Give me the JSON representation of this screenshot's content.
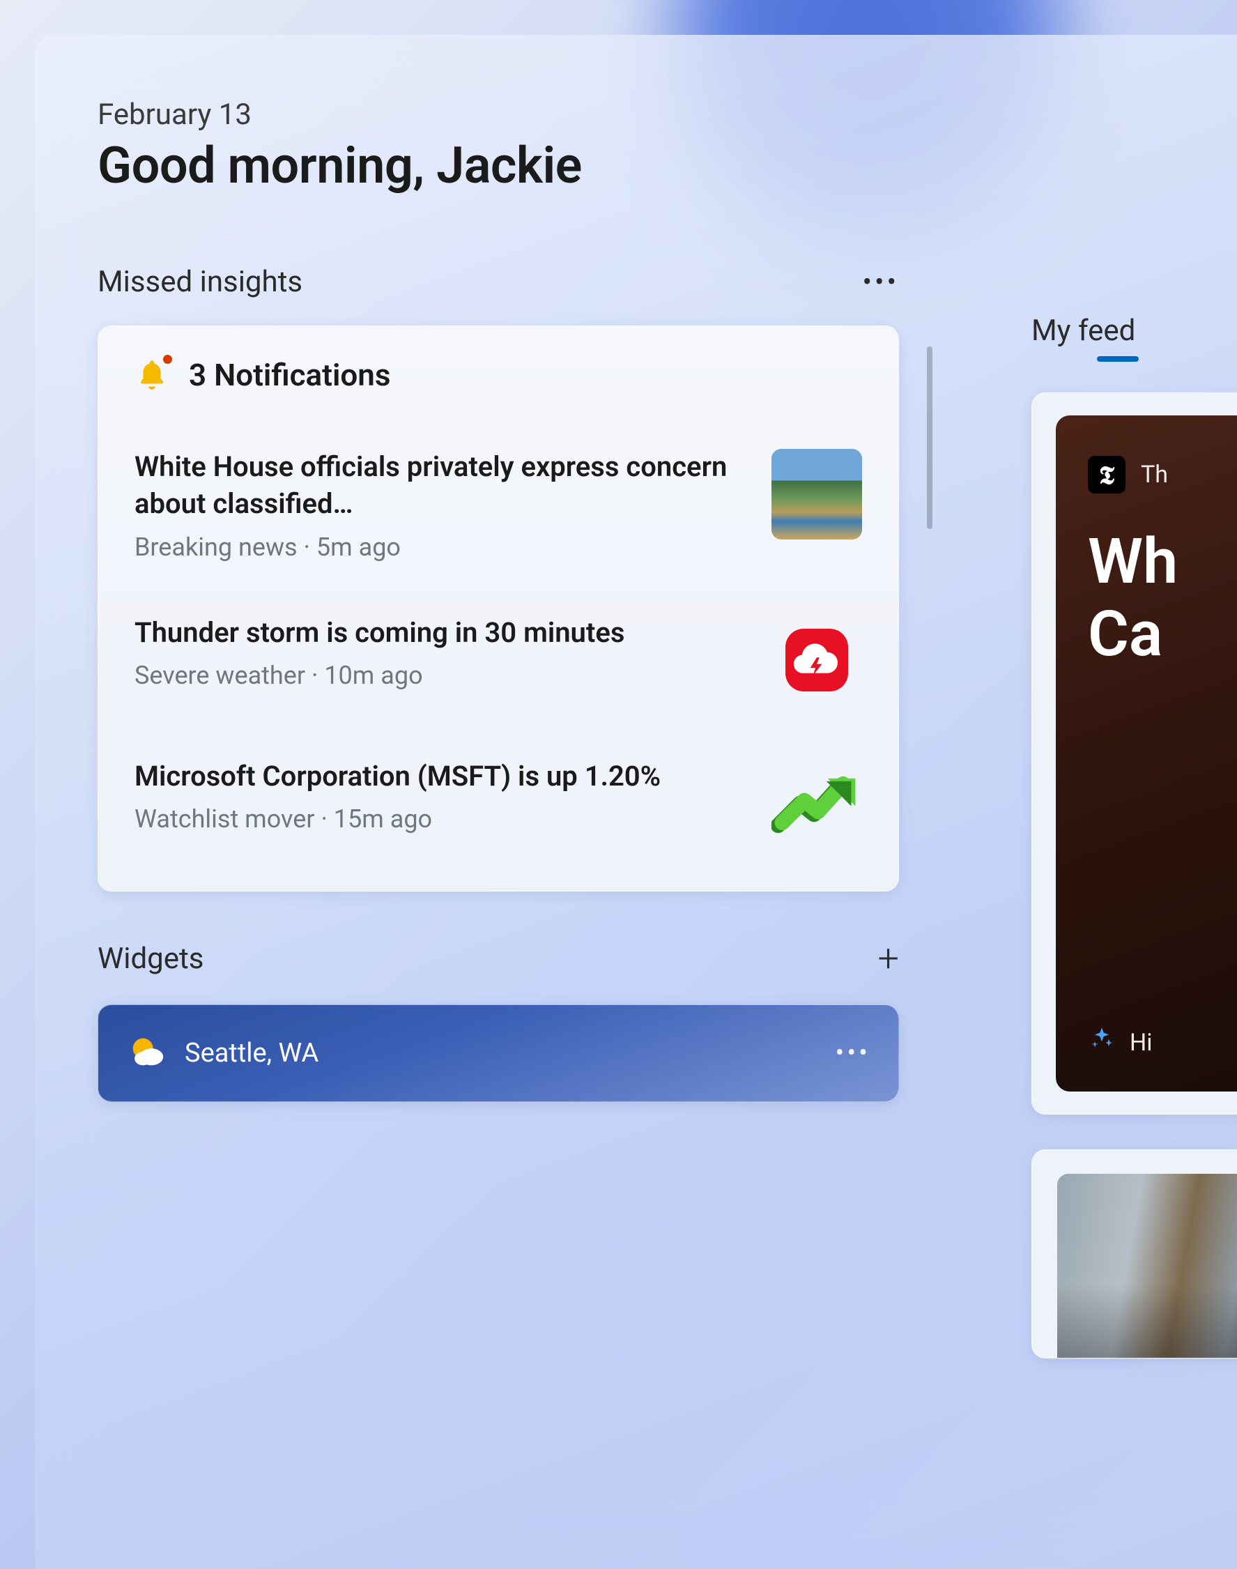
{
  "header": {
    "date": "February 13",
    "greeting": "Good morning, Jackie"
  },
  "insights": {
    "section_title": "Missed insights",
    "notifications_title": "3 Notifications",
    "items": [
      {
        "headline": "White House officials privately express concern about classified…",
        "category": "Breaking news",
        "time": "5m ago",
        "thumb": "photo"
      },
      {
        "headline": "Thunder storm is coming in 30 minutes",
        "category": "Severe weather",
        "time": "10m ago",
        "thumb": "storm"
      },
      {
        "headline": "Microsoft Corporation (MSFT) is up 1.20%",
        "category": "Watchlist mover",
        "time": "15m ago",
        "thumb": "stock-up"
      }
    ]
  },
  "widgets": {
    "section_title": "Widgets",
    "weather": {
      "location": "Seattle, WA"
    }
  },
  "feed": {
    "tab_label": "My feed",
    "hero": {
      "source_short": "Th",
      "headline_line1": "Wh",
      "headline_line2": "Ca",
      "footer_text": "Hi"
    }
  }
}
